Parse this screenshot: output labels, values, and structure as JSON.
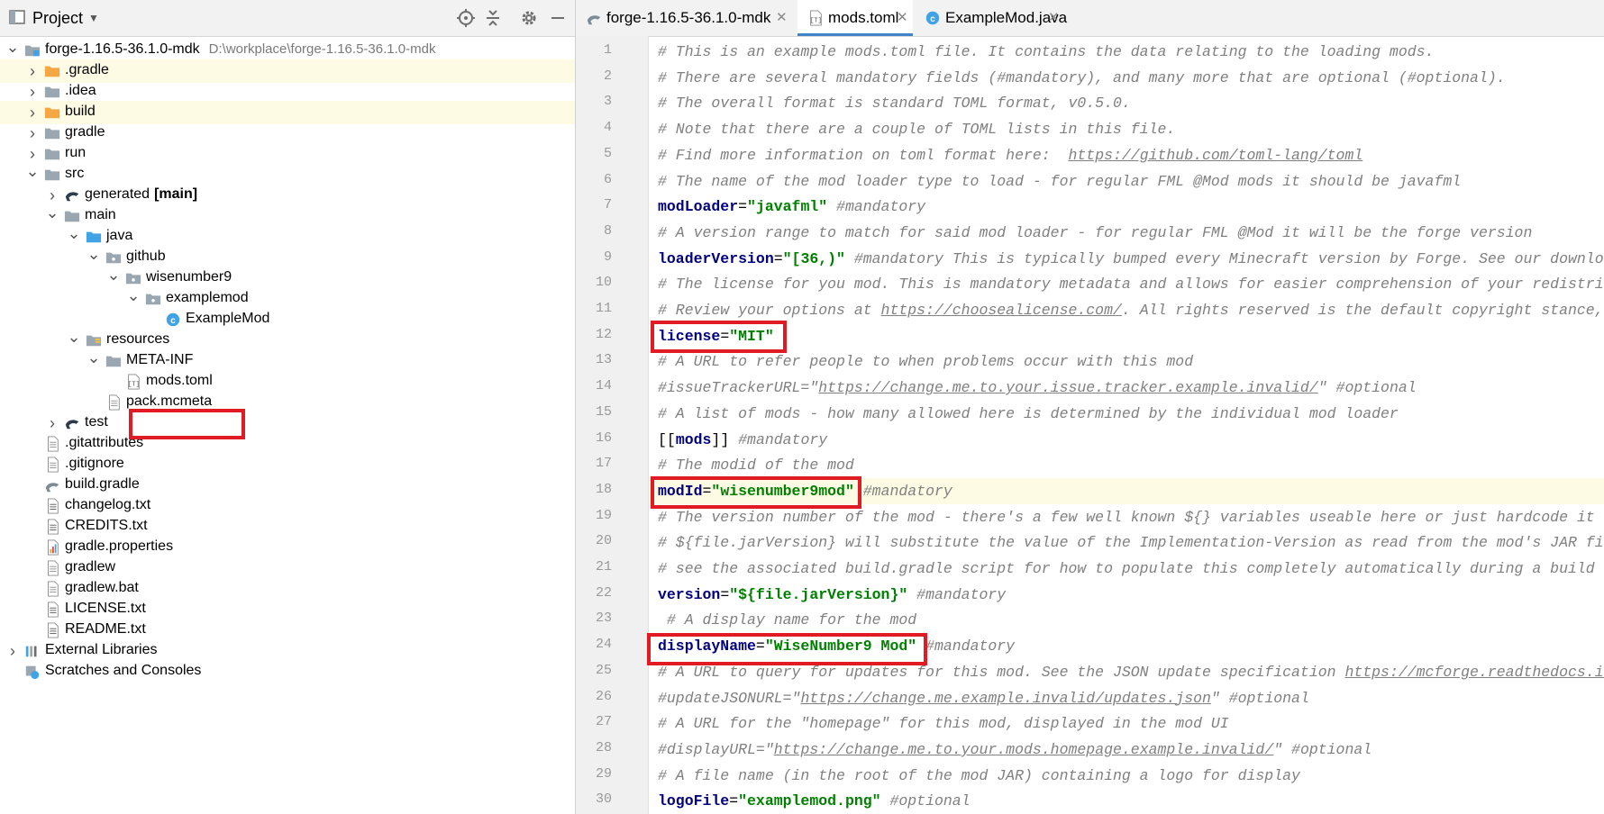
{
  "panel": {
    "title": "Project",
    "dropdown": "▼"
  },
  "tree": [
    {
      "label": "forge-1.16.5-36.1.0-mdk",
      "path": "D:\\workplace\\forge-1.16.5-36.1.0-mdk",
      "icon": "module-icon",
      "arrow": "down",
      "level": 0,
      "hl": false
    },
    {
      "label": ".gradle",
      "icon": "folder-orange-icon",
      "arrow": "right",
      "level": 1,
      "hl": true
    },
    {
      "label": ".idea",
      "icon": "folder-icon",
      "arrow": "right",
      "level": 1,
      "hl": false
    },
    {
      "label": "build",
      "icon": "folder-orange-icon",
      "arrow": "right",
      "level": 1,
      "hl": true
    },
    {
      "label": "gradle",
      "icon": "folder-icon",
      "arrow": "right",
      "level": 1,
      "hl": false
    },
    {
      "label": "run",
      "icon": "folder-icon",
      "arrow": "right",
      "level": 1,
      "hl": false
    },
    {
      "label": "src",
      "icon": "folder-icon",
      "arrow": "down",
      "level": 1,
      "hl": false
    },
    {
      "label": "generated",
      "bold": "[main]",
      "icon": "gradle-source-icon",
      "arrow": "right",
      "level": 2,
      "hl": false
    },
    {
      "label": "main",
      "icon": "folder-icon",
      "arrow": "down",
      "level": 2,
      "hl": false
    },
    {
      "label": "java",
      "icon": "folder-blue-icon",
      "arrow": "down",
      "level": 3,
      "hl": false
    },
    {
      "label": "github",
      "icon": "package-icon",
      "arrow": "down",
      "level": 4,
      "hl": false
    },
    {
      "label": "wisenumber9",
      "icon": "package-icon",
      "arrow": "down",
      "level": 5,
      "hl": false
    },
    {
      "label": "examplemod",
      "icon": "package-icon",
      "arrow": "down",
      "level": 6,
      "hl": false
    },
    {
      "label": "ExampleMod",
      "icon": "java-class-icon",
      "arrow": "",
      "level": 7,
      "hl": false
    },
    {
      "label": "resources",
      "icon": "resources-folder-icon",
      "arrow": "down",
      "level": 3,
      "hl": false
    },
    {
      "label": "META-INF",
      "icon": "folder-icon",
      "arrow": "down",
      "level": 4,
      "hl": false
    },
    {
      "label": "mods.toml",
      "icon": "toml-file-icon",
      "arrow": "",
      "level": 5,
      "hl": false
    },
    {
      "label": "pack.mcmeta",
      "icon": "file-icon",
      "arrow": "",
      "level": 4,
      "hl": false
    },
    {
      "label": "test",
      "icon": "gradle-source-icon",
      "arrow": "right",
      "level": 2,
      "hl": false
    },
    {
      "label": ".gitattributes",
      "icon": "file-icon",
      "arrow": "",
      "level": 1,
      "hl": false
    },
    {
      "label": ".gitignore",
      "icon": "file-icon",
      "arrow": "",
      "level": 1,
      "hl": false
    },
    {
      "label": "build.gradle",
      "icon": "gradle-icon",
      "arrow": "",
      "level": 1,
      "hl": false
    },
    {
      "label": "changelog.txt",
      "icon": "text-file-icon",
      "arrow": "",
      "level": 1,
      "hl": false
    },
    {
      "label": "CREDITS.txt",
      "icon": "text-file-icon",
      "arrow": "",
      "level": 1,
      "hl": false
    },
    {
      "label": "gradle.properties",
      "icon": "properties-file-icon",
      "arrow": "",
      "level": 1,
      "hl": false
    },
    {
      "label": "gradlew",
      "icon": "file-icon",
      "arrow": "",
      "level": 1,
      "hl": false
    },
    {
      "label": "gradlew.bat",
      "icon": "file-icon",
      "arrow": "",
      "level": 1,
      "hl": false
    },
    {
      "label": "LICENSE.txt",
      "icon": "text-file-icon",
      "arrow": "",
      "level": 1,
      "hl": false
    },
    {
      "label": "README.txt",
      "icon": "text-file-icon",
      "arrow": "",
      "level": 1,
      "hl": false
    },
    {
      "label": "External Libraries",
      "icon": "libraries-icon",
      "arrow": "right",
      "level": 0,
      "hl": false
    },
    {
      "label": "Scratches and Consoles",
      "icon": "scratches-icon",
      "arrow": "",
      "level": 0,
      "hl": false
    }
  ],
  "tabs": [
    {
      "label": "forge-1.16.5-36.1.0-mdk",
      "icon": "gradle-icon",
      "active": false
    },
    {
      "label": "mods.toml",
      "icon": "toml-file-icon",
      "active": true
    },
    {
      "label": "ExampleMod.java",
      "icon": "java-class-icon",
      "active": false
    }
  ],
  "code": [
    {
      "n": "1",
      "t": [
        [
          "cm",
          "# This is an example mods.toml file. It contains the data relating to the loading mods."
        ]
      ]
    },
    {
      "n": "2",
      "t": [
        [
          "cm",
          "# There are several mandatory fields (#mandatory), and many more that are optional (#optional)."
        ]
      ]
    },
    {
      "n": "3",
      "t": [
        [
          "cm",
          "# The overall format is standard TOML format, v0.5.0."
        ]
      ]
    },
    {
      "n": "4",
      "t": [
        [
          "cm",
          "# Note that there are a couple of TOML lists in this file."
        ]
      ]
    },
    {
      "n": "5",
      "t": [
        [
          "cm",
          "# Find more information on toml format here:  "
        ],
        [
          "cmu",
          "https://github.com/toml-lang/toml"
        ]
      ]
    },
    {
      "n": "6",
      "t": [
        [
          "cm",
          "# The name of the mod loader type to load - for regular FML @Mod mods it should be javafml"
        ]
      ]
    },
    {
      "n": "7",
      "t": [
        [
          "ky",
          "modLoader"
        ],
        [
          "pu",
          "="
        ],
        [
          "st",
          "\"javafml\""
        ],
        [
          "cm",
          " #mandatory"
        ]
      ]
    },
    {
      "n": "8",
      "t": [
        [
          "cm",
          "# A version range to match for said mod loader - for regular FML @Mod it will be the forge version"
        ]
      ]
    },
    {
      "n": "9",
      "t": [
        [
          "ky",
          "loaderVersion"
        ],
        [
          "pu",
          "="
        ],
        [
          "st",
          "\"[36,)\""
        ],
        [
          "cm",
          " #mandatory This is typically bumped every Minecraft version by Forge. See our download page for lists of versions."
        ]
      ]
    },
    {
      "n": "10",
      "t": [
        [
          "cm",
          "# The license for you mod. This is mandatory metadata and allows for easier comprehension of your redistributive properties."
        ]
      ]
    },
    {
      "n": "11",
      "t": [
        [
          "cm",
          "# Review your options at "
        ],
        [
          "cmu",
          "https://choosealicense.com/"
        ],
        [
          "cm",
          ". All rights reserved is the default copyright stance, and is thus the default here."
        ]
      ]
    },
    {
      "n": "12",
      "t": [
        [
          "ky",
          "license"
        ],
        [
          "pu",
          "="
        ],
        [
          "st",
          "\"MIT\""
        ]
      ]
    },
    {
      "n": "13",
      "t": [
        [
          "cm",
          "# A URL to refer people to when problems occur with this mod"
        ]
      ]
    },
    {
      "n": "14",
      "t": [
        [
          "cm",
          "#issueTrackerURL=\""
        ],
        [
          "cmu",
          "https://change.me.to.your.issue.tracker.example.invalid/"
        ],
        [
          "cm",
          "\" #optional"
        ]
      ]
    },
    {
      "n": "15",
      "t": [
        [
          "cm",
          "# A list of mods - how many allowed here is determined by the individual mod loader"
        ]
      ]
    },
    {
      "n": "16",
      "t": [
        [
          "pu",
          "[["
        ],
        [
          "ky",
          "mods"
        ],
        [
          "pu",
          "]]"
        ],
        [
          "cm",
          " #mandatory"
        ]
      ]
    },
    {
      "n": "17",
      "t": [
        [
          "cm",
          "# The modid of the mod"
        ]
      ]
    },
    {
      "n": "18",
      "hl": true,
      "t": [
        [
          "ky",
          "modId"
        ],
        [
          "pu",
          "="
        ],
        [
          "st",
          "\"wisenumber9mod\""
        ],
        [
          "cm",
          " #mandatory"
        ]
      ]
    },
    {
      "n": "19",
      "t": [
        [
          "cm",
          "# The version number of the mod - there's a few well known ${} variables useable here or just hardcode it"
        ]
      ]
    },
    {
      "n": "20",
      "t": [
        [
          "cm",
          "# ${file.jarVersion} will substitute the value of the Implementation-Version as read from the mod's JAR file metadata"
        ]
      ]
    },
    {
      "n": "21",
      "t": [
        [
          "cm",
          "# see the associated build.gradle script for how to populate this completely automatically during a build"
        ]
      ]
    },
    {
      "n": "22",
      "t": [
        [
          "ky",
          "version"
        ],
        [
          "pu",
          "="
        ],
        [
          "st",
          "\"${file.jarVersion}\""
        ],
        [
          "cm",
          " #mandatory"
        ]
      ]
    },
    {
      "n": "23",
      "t": [
        [
          "cm",
          " # A display name for the mod"
        ]
      ]
    },
    {
      "n": "24",
      "t": [
        [
          "ky",
          "displayName"
        ],
        [
          "pu",
          "="
        ],
        [
          "st",
          "\"WiseNumber9 Mod\""
        ],
        [
          "cm",
          " #mandatory"
        ]
      ]
    },
    {
      "n": "25",
      "t": [
        [
          "cm",
          "# A URL to query for updates for this mod. See the JSON update specification "
        ],
        [
          "cmu",
          "https://mcforge.readthedocs.io/en/latest/gettingstarted/autoupdate/"
        ]
      ]
    },
    {
      "n": "26",
      "t": [
        [
          "cm",
          "#updateJSONURL=\""
        ],
        [
          "cmu",
          "https://change.me.example.invalid/updates.json"
        ],
        [
          "cm",
          "\" #optional"
        ]
      ]
    },
    {
      "n": "27",
      "t": [
        [
          "cm",
          "# A URL for the \"homepage\" for this mod, displayed in the mod UI"
        ]
      ]
    },
    {
      "n": "28",
      "t": [
        [
          "cm",
          "#displayURL=\""
        ],
        [
          "cmu",
          "https://change.me.to.your.mods.homepage.example.invalid/"
        ],
        [
          "cm",
          "\" #optional"
        ]
      ]
    },
    {
      "n": "29",
      "t": [
        [
          "cm",
          "# A file name (in the root of the mod JAR) containing a logo for display"
        ]
      ]
    },
    {
      "n": "30",
      "t": [
        [
          "ky",
          "logoFile"
        ],
        [
          "pu",
          "="
        ],
        [
          "st",
          "\"examplemod.png\""
        ],
        [
          "cm",
          " #optional"
        ]
      ]
    }
  ],
  "colors": {
    "accent": "#4083c9",
    "highlight_box": "#e01b24",
    "keyword": "#000080",
    "string": "#008000",
    "comment": "#808080"
  }
}
